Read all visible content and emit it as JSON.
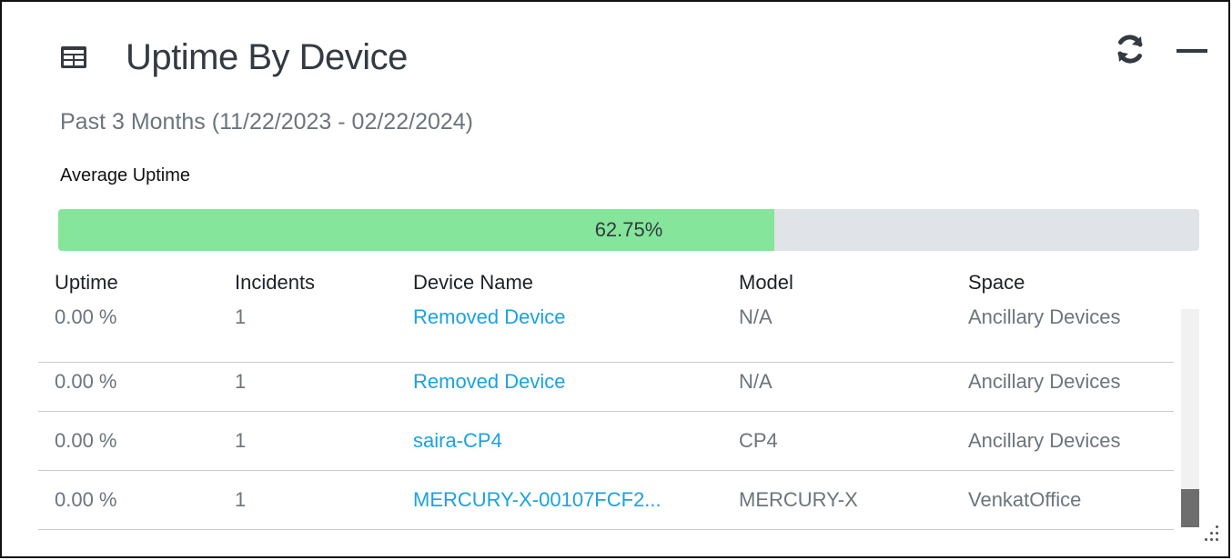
{
  "widget": {
    "title": "Uptime By Device",
    "title_icon": "table-icon",
    "subtitle": "Past 3 Months (11/22/2023 - 02/22/2024)",
    "average_label": "Average Uptime",
    "average_value_text": "62.75%",
    "average_value": 62.75,
    "actions": {
      "refresh_icon": "refresh-icon",
      "minimize_icon": "minimize-icon"
    }
  },
  "table": {
    "columns": [
      "Uptime",
      "Incidents",
      "Device Name",
      "Model",
      "Space"
    ],
    "rows": [
      {
        "uptime": "0.00 %",
        "incidents": "1",
        "device_name": "Removed Device",
        "model": "N/A",
        "space": "Ancillary Devices"
      },
      {
        "uptime": "0.00 %",
        "incidents": "1",
        "device_name": "Removed Device",
        "model": "N/A",
        "space": "Ancillary Devices"
      },
      {
        "uptime": "0.00 %",
        "incidents": "1",
        "device_name": "saira-CP4",
        "model": "CP4",
        "space": "Ancillary Devices"
      },
      {
        "uptime": "0.00 %",
        "incidents": "1",
        "device_name": "MERCURY-X-00107FCF2...",
        "model": "MERCURY-X",
        "space": "VenkatOffice"
      }
    ]
  },
  "colors": {
    "progress_fill": "#85e59b",
    "progress_track": "#e0e3e7",
    "link": "#1ba2e0",
    "muted_text": "#6c747c",
    "heading_text": "#333a42"
  }
}
